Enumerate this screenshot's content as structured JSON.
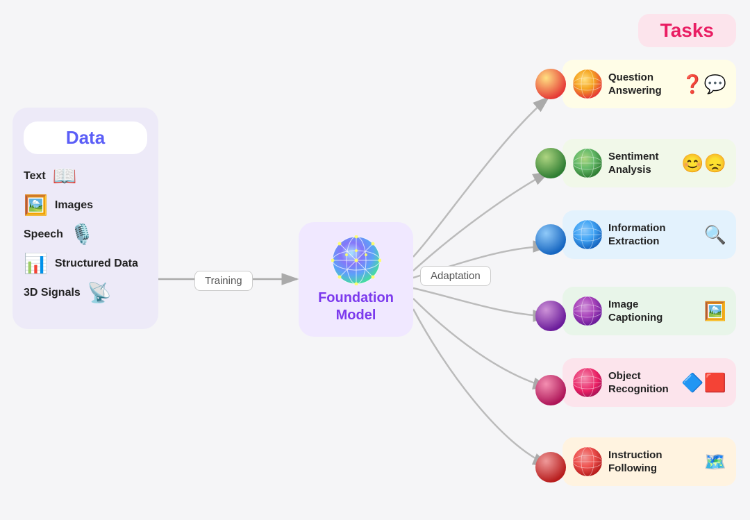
{
  "data_panel": {
    "title": "Data",
    "items": [
      {
        "label": "Text",
        "icon": "📖"
      },
      {
        "label": "Images",
        "icon": "🖼️"
      },
      {
        "label": "Speech",
        "icon": "🎤"
      },
      {
        "label": "Structured Data",
        "icon": "📊"
      },
      {
        "label": "3D Signals",
        "icon": "📡"
      }
    ]
  },
  "training_label": "Training",
  "adaptation_label": "Adaptation",
  "foundation_model_label": "Foundation\nModel",
  "tasks_header": "Tasks",
  "tasks": [
    {
      "label": "Question\nAnswering",
      "icon": "❓💬",
      "class": "task-qa",
      "sphere_color": "#f5c542"
    },
    {
      "label": "Sentiment\nAnalysis",
      "icon": "😊😞",
      "class": "task-sa",
      "sphere_color": "#66bb6a"
    },
    {
      "label": "Information\nExtraction",
      "icon": "🔍",
      "class": "task-ie",
      "sphere_color": "#42a5f5"
    },
    {
      "label": "Image\nCaptioning",
      "icon": "🖼️",
      "class": "task-ic",
      "sphere_color": "#ab47bc"
    },
    {
      "label": "Object\nRecognition",
      "icon": "🔷🟥",
      "class": "task-or",
      "sphere_color": "#ec407a"
    },
    {
      "label": "Instruction\nFollowing",
      "icon": "🗺️",
      "class": "task-if",
      "sphere_color": "#ef5350"
    }
  ]
}
